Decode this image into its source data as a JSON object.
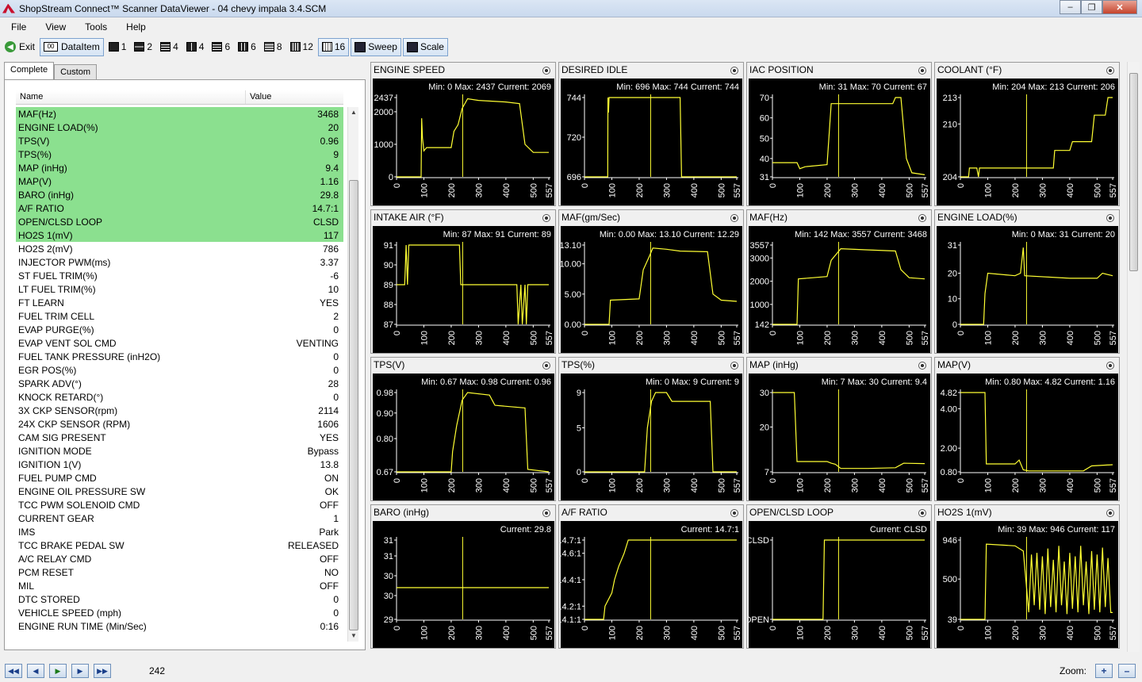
{
  "window": {
    "title": "ShopStream Connect™ Scanner DataViewer - 04 chevy impala 3.4.SCM"
  },
  "menu": [
    "File",
    "View",
    "Tools",
    "Help"
  ],
  "toolbar": {
    "exit": "Exit",
    "dataitem": "DataItem",
    "layouts": [
      "1",
      "2",
      "4",
      "4",
      "6",
      "6",
      "8",
      "12",
      "16"
    ],
    "sweep": "Sweep",
    "scale": "Scale"
  },
  "tabs": [
    "Complete",
    "Custom"
  ],
  "list": {
    "header_name": "Name",
    "header_value": "Value",
    "rows": [
      {
        "name": "MAF(Hz)",
        "value": "3468",
        "hl": true
      },
      {
        "name": "ENGINE LOAD(%)",
        "value": "20",
        "hl": true
      },
      {
        "name": "TPS(V)",
        "value": "0.96",
        "hl": true
      },
      {
        "name": "TPS(%)",
        "value": "9",
        "hl": true
      },
      {
        "name": "MAP (inHg)",
        "value": "9.4",
        "hl": true
      },
      {
        "name": "MAP(V)",
        "value": "1.16",
        "hl": true
      },
      {
        "name": "BARO (inHg)",
        "value": "29.8",
        "hl": true
      },
      {
        "name": "A/F RATIO",
        "value": "14.7:1",
        "hl": true
      },
      {
        "name": "OPEN/CLSD LOOP",
        "value": "CLSD",
        "hl": true
      },
      {
        "name": "HO2S 1(mV)",
        "value": "117",
        "hl": true
      },
      {
        "name": "HO2S 2(mV)",
        "value": "786",
        "hl": false
      },
      {
        "name": "INJECTOR PWM(ms)",
        "value": "3.37",
        "hl": false
      },
      {
        "name": "ST FUEL TRIM(%)",
        "value": "-6",
        "hl": false
      },
      {
        "name": "LT FUEL TRIM(%)",
        "value": "10",
        "hl": false
      },
      {
        "name": "FT LEARN",
        "value": "YES",
        "hl": false
      },
      {
        "name": "FUEL TRIM CELL",
        "value": "2",
        "hl": false
      },
      {
        "name": "EVAP PURGE(%)",
        "value": "0",
        "hl": false
      },
      {
        "name": "EVAP VENT SOL CMD",
        "value": "VENTING",
        "hl": false
      },
      {
        "name": "FUEL TANK PRESSURE  (inH2O)",
        "value": "0",
        "hl": false
      },
      {
        "name": "EGR POS(%)",
        "value": "0",
        "hl": false
      },
      {
        "name": "SPARK ADV(°)",
        "value": "28",
        "hl": false
      },
      {
        "name": "KNOCK RETARD(°)",
        "value": "0",
        "hl": false
      },
      {
        "name": "3X CKP SENSOR(rpm)",
        "value": "2114",
        "hl": false
      },
      {
        "name": "24X CKP SENSOR (RPM)",
        "value": "1606",
        "hl": false
      },
      {
        "name": "CAM SIG PRESENT",
        "value": "YES",
        "hl": false
      },
      {
        "name": "IGNITION MODE",
        "value": "Bypass",
        "hl": false
      },
      {
        "name": "IGNITION 1(V)",
        "value": "13.8",
        "hl": false
      },
      {
        "name": "FUEL PUMP CMD",
        "value": "ON",
        "hl": false
      },
      {
        "name": "ENGINE OIL PRESSURE SW",
        "value": "OK",
        "hl": false
      },
      {
        "name": "TCC PWM SOLENOID CMD",
        "value": "OFF",
        "hl": false
      },
      {
        "name": "CURRENT GEAR",
        "value": "1",
        "hl": false
      },
      {
        "name": "IMS",
        "value": "Park",
        "hl": false
      },
      {
        "name": "TCC BRAKE PEDAL SW",
        "value": "RELEASED",
        "hl": false
      },
      {
        "name": "A/C RELAY CMD",
        "value": "OFF",
        "hl": false
      },
      {
        "name": "PCM RESET",
        "value": "NO",
        "hl": false
      },
      {
        "name": "MIL",
        "value": "OFF",
        "hl": false
      },
      {
        "name": "DTC STORED",
        "value": "0",
        "hl": false
      },
      {
        "name": "VEHICLE SPEED (mph)",
        "value": "0",
        "hl": false
      },
      {
        "name": "ENGINE RUN TIME (Min/Sec)",
        "value": "0:16",
        "hl": false
      }
    ]
  },
  "colors": {
    "trace": "#ffff33",
    "highlight": "#8be08f",
    "plot_bg": "#000000"
  },
  "x_ticks": [
    "0",
    "100",
    "200",
    "300",
    "400",
    "500",
    "557"
  ],
  "cursor_x": 242,
  "graphs": [
    {
      "title": "ENGINE SPEED",
      "stats": "Min: 0    Max: 2437    Current: 2069",
      "yticks": [
        "2437",
        "2000",
        "1000",
        "0"
      ],
      "ymin": 0,
      "ymax": 2437,
      "yvals": [
        2437,
        2000,
        1000,
        0
      ],
      "pts": [
        [
          0,
          0
        ],
        [
          90,
          0
        ],
        [
          92,
          1800
        ],
        [
          95,
          1200
        ],
        [
          100,
          800
        ],
        [
          110,
          900
        ],
        [
          200,
          900
        ],
        [
          210,
          1400
        ],
        [
          225,
          1600
        ],
        [
          240,
          2100
        ],
        [
          260,
          2400
        ],
        [
          300,
          2350
        ],
        [
          400,
          2300
        ],
        [
          450,
          2250
        ],
        [
          470,
          1000
        ],
        [
          500,
          750
        ],
        [
          557,
          750
        ]
      ]
    },
    {
      "title": "DESIRED IDLE",
      "stats": "Min: 696    Max: 744    Current: 744",
      "yticks": [
        "744",
        "720",
        "696"
      ],
      "ymin": 696,
      "ymax": 744,
      "yvals": [
        744,
        720,
        696
      ],
      "pts": [
        [
          0,
          696
        ],
        [
          85,
          696
        ],
        [
          86,
          744
        ],
        [
          88,
          735
        ],
        [
          90,
          744
        ],
        [
          350,
          744
        ],
        [
          355,
          696
        ],
        [
          557,
          696
        ]
      ]
    },
    {
      "title": "IAC POSITION",
      "stats": "Min: 31    Max: 70    Current: 67",
      "yticks": [
        "70",
        "60",
        "50",
        "40",
        "31"
      ],
      "ymin": 31,
      "ymax": 70,
      "yvals": [
        70,
        60,
        50,
        40,
        31
      ],
      "pts": [
        [
          0,
          38
        ],
        [
          90,
          38
        ],
        [
          100,
          35
        ],
        [
          120,
          36
        ],
        [
          200,
          37
        ],
        [
          215,
          67
        ],
        [
          440,
          67
        ],
        [
          450,
          70
        ],
        [
          470,
          70
        ],
        [
          490,
          40
        ],
        [
          510,
          33
        ],
        [
          557,
          32
        ]
      ]
    },
    {
      "title": "COOLANT (°F)",
      "stats": "Min: 204    Max: 213    Current: 206",
      "yticks": [
        "213",
        "210",
        "204"
      ],
      "ymin": 204,
      "ymax": 213,
      "yvals": [
        213,
        210,
        204
      ],
      "pts": [
        [
          0,
          204
        ],
        [
          30,
          204
        ],
        [
          33,
          205
        ],
        [
          40,
          205
        ],
        [
          60,
          205
        ],
        [
          66,
          204
        ],
        [
          70,
          205
        ],
        [
          340,
          205
        ],
        [
          345,
          207
        ],
        [
          400,
          207
        ],
        [
          410,
          208
        ],
        [
          480,
          208
        ],
        [
          490,
          211
        ],
        [
          530,
          211
        ],
        [
          540,
          213
        ],
        [
          557,
          213
        ]
      ]
    },
    {
      "title": "INTAKE AIR (°F)",
      "stats": "Min: 87    Max: 91    Current: 89",
      "yticks": [
        "91",
        "90",
        "89",
        "88",
        "87"
      ],
      "ymin": 87,
      "ymax": 91,
      "yvals": [
        91,
        90,
        89,
        88,
        87
      ],
      "pts": [
        [
          0,
          89
        ],
        [
          30,
          89
        ],
        [
          35,
          91
        ],
        [
          40,
          89
        ],
        [
          45,
          91
        ],
        [
          230,
          91
        ],
        [
          235,
          89
        ],
        [
          440,
          89
        ],
        [
          445,
          87
        ],
        [
          455,
          89
        ],
        [
          460,
          87
        ],
        [
          470,
          89
        ],
        [
          475,
          87
        ],
        [
          480,
          89
        ],
        [
          557,
          89
        ]
      ]
    },
    {
      "title": "MAF(gm/Sec)",
      "stats": "Min: 0.00    Max: 13.10    Current: 12.29",
      "yticks": [
        "13.10",
        "10.00",
        "5.00",
        "0.00"
      ],
      "ymin": 0,
      "ymax": 13.1,
      "yvals": [
        13.1,
        10,
        5,
        0
      ],
      "pts": [
        [
          0,
          0
        ],
        [
          90,
          0
        ],
        [
          95,
          4
        ],
        [
          200,
          4.2
        ],
        [
          215,
          9
        ],
        [
          235,
          11
        ],
        [
          250,
          12.6
        ],
        [
          300,
          12.4
        ],
        [
          350,
          12.1
        ],
        [
          450,
          12
        ],
        [
          470,
          5
        ],
        [
          500,
          4
        ],
        [
          557,
          3.8
        ]
      ]
    },
    {
      "title": "MAF(Hz)",
      "stats": "Min: 142    Max: 3557    Current: 3468",
      "yticks": [
        "3557",
        "3000",
        "2000",
        "1000",
        "142"
      ],
      "ymin": 142,
      "ymax": 3557,
      "yvals": [
        3557,
        3000,
        2000,
        1000,
        142
      ],
      "pts": [
        [
          0,
          142
        ],
        [
          90,
          142
        ],
        [
          95,
          2100
        ],
        [
          200,
          2200
        ],
        [
          215,
          2900
        ],
        [
          250,
          3400
        ],
        [
          350,
          3350
        ],
        [
          450,
          3300
        ],
        [
          470,
          2500
        ],
        [
          500,
          2150
        ],
        [
          557,
          2100
        ]
      ]
    },
    {
      "title": "ENGINE LOAD(%)",
      "stats": "Min: 0    Max: 31    Current: 20",
      "yticks": [
        "31",
        "20",
        "10",
        "0"
      ],
      "ymin": 0,
      "ymax": 31,
      "yvals": [
        31,
        20,
        10,
        0
      ],
      "pts": [
        [
          0,
          0
        ],
        [
          85,
          0
        ],
        [
          90,
          12
        ],
        [
          100,
          20
        ],
        [
          200,
          19
        ],
        [
          220,
          20
        ],
        [
          230,
          30
        ],
        [
          235,
          19
        ],
        [
          400,
          18
        ],
        [
          500,
          18
        ],
        [
          520,
          20
        ],
        [
          557,
          19
        ]
      ]
    },
    {
      "title": "TPS(V)",
      "stats": "Min: 0.67    Max: 0.98    Current: 0.96",
      "yticks": [
        "0.98",
        "0.90",
        "0.80",
        "0.67"
      ],
      "ymin": 0.67,
      "ymax": 0.98,
      "yvals": [
        0.98,
        0.9,
        0.8,
        0.67
      ],
      "pts": [
        [
          0,
          0.67
        ],
        [
          200,
          0.67
        ],
        [
          205,
          0.75
        ],
        [
          220,
          0.85
        ],
        [
          240,
          0.95
        ],
        [
          260,
          0.98
        ],
        [
          340,
          0.97
        ],
        [
          360,
          0.93
        ],
        [
          470,
          0.92
        ],
        [
          480,
          0.68
        ],
        [
          557,
          0.67
        ]
      ]
    },
    {
      "title": "TPS(%)",
      "stats": "Min: 0    Max: 9    Current: 9",
      "yticks": [
        "9",
        "5",
        "0"
      ],
      "ymin": 0,
      "ymax": 9,
      "yvals": [
        9,
        5,
        0
      ],
      "pts": [
        [
          0,
          0
        ],
        [
          220,
          0
        ],
        [
          230,
          5
        ],
        [
          245,
          8
        ],
        [
          260,
          9
        ],
        [
          300,
          9
        ],
        [
          320,
          8
        ],
        [
          400,
          8
        ],
        [
          460,
          8
        ],
        [
          470,
          0
        ],
        [
          557,
          0
        ]
      ]
    },
    {
      "title": "MAP (inHg)",
      "stats": "Min: 7    Max: 30    Current: 9.4",
      "yticks": [
        "30",
        "20",
        "7"
      ],
      "ymin": 7,
      "ymax": 30,
      "yvals": [
        30,
        20,
        7
      ],
      "pts": [
        [
          0,
          30
        ],
        [
          80,
          30
        ],
        [
          90,
          10
        ],
        [
          200,
          10
        ],
        [
          215,
          9.5
        ],
        [
          230,
          9.2
        ],
        [
          250,
          8
        ],
        [
          350,
          8
        ],
        [
          450,
          8.2
        ],
        [
          480,
          9.5
        ],
        [
          557,
          9.4
        ]
      ]
    },
    {
      "title": "MAP(V)",
      "stats": "Min: 0.80    Max: 4.82    Current: 1.16",
      "yticks": [
        "4.82",
        "4.00",
        "2.00",
        "0.80"
      ],
      "ymin": 0.8,
      "ymax": 4.82,
      "yvals": [
        4.82,
        4,
        2,
        0.8
      ],
      "pts": [
        [
          0,
          4.82
        ],
        [
          90,
          4.82
        ],
        [
          95,
          1.2
        ],
        [
          200,
          1.2
        ],
        [
          215,
          1.4
        ],
        [
          230,
          0.9
        ],
        [
          250,
          0.85
        ],
        [
          450,
          0.85
        ],
        [
          480,
          1.1
        ],
        [
          557,
          1.16
        ]
      ]
    },
    {
      "title": "BARO (inHg)",
      "stats": "Current: 29.8",
      "yticks": [
        "31",
        "31",
        "30",
        "30",
        "29"
      ],
      "ymin": 29,
      "ymax": 31,
      "yvals": [
        31,
        30.6,
        30.1,
        29.6,
        29
      ],
      "pts": [
        [
          0,
          29.8
        ],
        [
          557,
          29.8
        ]
      ]
    },
    {
      "title": "A/F RATIO",
      "stats": "Current: 14.7:1",
      "yticks": [
        "14.7:1",
        "14.6:1",
        "14.4:1",
        "14.2:1",
        "14.1:1"
      ],
      "ymin": 14.1,
      "ymax": 14.7,
      "yvals": [
        14.7,
        14.6,
        14.4,
        14.2,
        14.1
      ],
      "pts": [
        [
          0,
          14.1
        ],
        [
          70,
          14.1
        ],
        [
          75,
          14.2
        ],
        [
          100,
          14.3
        ],
        [
          110,
          14.4
        ],
        [
          125,
          14.5
        ],
        [
          145,
          14.6
        ],
        [
          160,
          14.7
        ],
        [
          557,
          14.7
        ]
      ]
    },
    {
      "title": "OPEN/CLSD LOOP",
      "stats": "Current: CLSD",
      "yticks": [
        "CLSD",
        "OPEN"
      ],
      "ymin": 0,
      "ymax": 1,
      "yvals": [
        1,
        0
      ],
      "pts": [
        [
          0,
          0
        ],
        [
          185,
          0
        ],
        [
          190,
          1
        ],
        [
          557,
          1
        ]
      ]
    },
    {
      "title": "HO2S 1(mV)",
      "stats": "Min: 39    Max: 946    Current: 117",
      "yticks": [
        "946",
        "500",
        "39"
      ],
      "ymin": 39,
      "ymax": 946,
      "yvals": [
        946,
        500,
        39
      ],
      "pts": [
        [
          0,
          39
        ],
        [
          90,
          39
        ],
        [
          95,
          900
        ],
        [
          200,
          880
        ],
        [
          230,
          820
        ],
        [
          250,
          120
        ],
        [
          260,
          780
        ],
        [
          270,
          200
        ],
        [
          280,
          800
        ],
        [
          290,
          150
        ],
        [
          300,
          760
        ],
        [
          310,
          100
        ],
        [
          320,
          850
        ],
        [
          330,
          180
        ],
        [
          340,
          720
        ],
        [
          350,
          120
        ],
        [
          360,
          880
        ],
        [
          370,
          200
        ],
        [
          380,
          700
        ],
        [
          390,
          100
        ],
        [
          400,
          800
        ],
        [
          410,
          160
        ],
        [
          420,
          760
        ],
        [
          430,
          120
        ],
        [
          440,
          880
        ],
        [
          450,
          200
        ],
        [
          460,
          700
        ],
        [
          470,
          100
        ],
        [
          480,
          820
        ],
        [
          490,
          150
        ],
        [
          500,
          780
        ],
        [
          510,
          120
        ],
        [
          520,
          860
        ],
        [
          530,
          180
        ],
        [
          540,
          740
        ],
        [
          550,
          117
        ],
        [
          557,
          117
        ]
      ]
    }
  ],
  "bottom": {
    "frame": "242",
    "zoom_label": "Zoom:"
  }
}
